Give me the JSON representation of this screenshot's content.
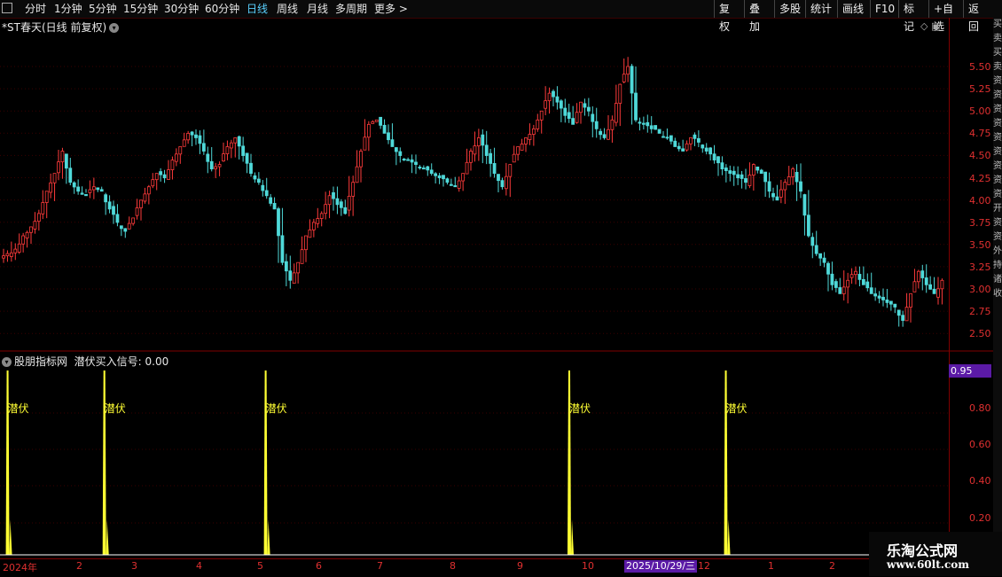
{
  "toolbar": {
    "tabs": [
      "分时",
      "1分钟",
      "5分钟",
      "15分钟",
      "30分钟",
      "60分钟",
      "日线",
      "周线",
      "月线",
      "多周期",
      "更多 >"
    ],
    "active_tab": "日线",
    "right_buttons": [
      "复权",
      "叠加",
      "多股",
      "统计",
      "画线",
      "F10",
      "标记",
      "+自选",
      "返回"
    ]
  },
  "main_chart": {
    "title": "*ST春天(日线 前复权)",
    "price_ticks": [
      "5.50",
      "5.25",
      "5.00",
      "4.75",
      "4.50",
      "4.25",
      "4.00",
      "3.75",
      "3.50",
      "3.25",
      "3.00",
      "2.75",
      "2.50"
    ]
  },
  "sub_chart": {
    "title": "股朋指标网",
    "signal_label": "潜伏买入信号:",
    "signal_value": "0.00",
    "marker_text": "潜伏",
    "current_value": "0.95",
    "ticks": [
      "0.80",
      "0.60",
      "0.40",
      "0.20"
    ]
  },
  "timeline": {
    "months": [
      "2024年",
      "2",
      "3",
      "4",
      "5",
      "6",
      "7",
      "8",
      "9",
      "10",
      "12",
      "1",
      "2"
    ],
    "highlight_date": "2025/10/29/三"
  },
  "watermark": {
    "line1": "乐淘公式网",
    "line2": "www.60lt.com"
  },
  "colors": {
    "up": "#ff3b3b",
    "down": "#4fd9d9",
    "signal": "#ffff33",
    "axis": "#e03030",
    "highlight": "#5b1aa6"
  },
  "chart_data": {
    "type": "candlestick",
    "price_range": [
      2.4,
      5.8
    ],
    "closes": [
      3.4,
      3.45,
      3.6,
      3.7,
      3.85,
      4.1,
      4.3,
      4.55,
      4.2,
      4.1,
      4.05,
      4.15,
      4.1,
      3.9,
      3.75,
      3.65,
      3.8,
      4.0,
      4.15,
      4.3,
      4.25,
      4.45,
      4.6,
      4.75,
      4.7,
      4.55,
      4.35,
      4.4,
      4.6,
      4.7,
      4.5,
      4.3,
      4.2,
      4.05,
      3.9,
      3.3,
      3.1,
      3.3,
      3.6,
      3.75,
      3.85,
      4.05,
      3.95,
      3.85,
      4.2,
      4.55,
      4.85,
      4.9,
      4.75,
      4.6,
      4.5,
      4.45,
      4.4,
      4.35,
      4.3,
      4.25,
      4.2,
      4.15,
      4.3,
      4.55,
      4.7,
      4.5,
      4.3,
      4.15,
      4.4,
      4.6,
      4.7,
      4.8,
      5.0,
      5.2,
      5.1,
      4.95,
      4.85,
      5.1,
      5.0,
      4.8,
      4.7,
      4.9,
      5.3,
      5.5,
      4.9,
      4.85,
      4.8,
      4.75,
      4.7,
      4.6,
      4.55,
      4.7,
      4.65,
      4.55,
      4.45,
      4.35,
      4.3,
      4.25,
      4.2,
      4.4,
      4.3,
      4.1,
      4.0,
      4.2,
      4.35,
      4.1,
      3.6,
      3.4,
      3.3,
      3.05,
      2.95,
      3.1,
      3.2,
      3.05,
      2.95,
      2.9,
      2.85,
      2.8,
      2.65,
      2.95,
      3.2,
      3.05,
      2.95,
      3.1
    ],
    "signal_x": [
      0.008,
      0.11,
      0.28,
      0.6,
      0.765
    ],
    "signal_values": [
      1,
      1,
      1,
      1,
      1
    ],
    "sub_range": [
      0,
      1
    ]
  }
}
